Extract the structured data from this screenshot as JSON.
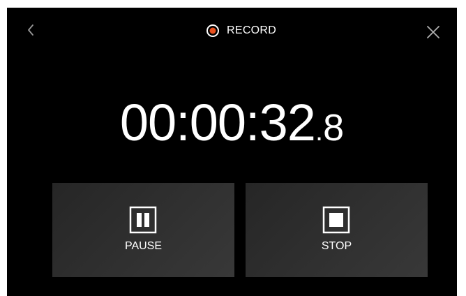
{
  "header": {
    "record_label": "RECORD",
    "record_color": "#e8501e"
  },
  "timer": {
    "main": "00:00:32",
    "fraction_separator": ".",
    "fraction": "8"
  },
  "controls": {
    "pause_label": "PAUSE",
    "stop_label": "STOP"
  },
  "icons": {
    "back": "chevron-left-icon",
    "close": "close-icon",
    "record": "record-dot-icon",
    "pause": "pause-icon",
    "stop": "stop-icon"
  }
}
